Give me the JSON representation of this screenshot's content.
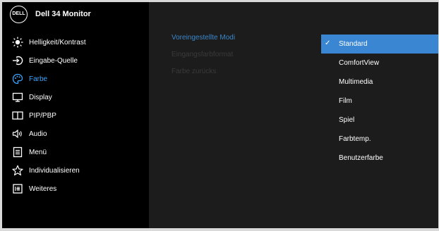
{
  "header": {
    "logo_text": "DELL",
    "title": "Dell 34 Monitor"
  },
  "menu": [
    {
      "label": "Helligkeit/Kontrast",
      "icon": "brightness-icon",
      "active": false
    },
    {
      "label": "Eingabe-Quelle",
      "icon": "input-source-icon",
      "active": false
    },
    {
      "label": "Farbe",
      "icon": "color-palette-icon",
      "active": true
    },
    {
      "label": "Display",
      "icon": "display-icon",
      "active": false
    },
    {
      "label": "PIP/PBP",
      "icon": "pip-pbp-icon",
      "active": false
    },
    {
      "label": "Audio",
      "icon": "speaker-icon",
      "active": false
    },
    {
      "label": "Menü",
      "icon": "menu-icon",
      "active": false
    },
    {
      "label": "Individualisieren",
      "icon": "star-icon",
      "active": false
    },
    {
      "label": "Weiteres",
      "icon": "others-icon",
      "active": false
    }
  ],
  "submenu": [
    {
      "label": "Voreingestellte Modi",
      "enabled": true
    },
    {
      "label": "Eingangsfarbformat",
      "enabled": false
    },
    {
      "label": "Farbe zurücks",
      "enabled": false
    }
  ],
  "options": [
    {
      "label": "Standard",
      "selected": true
    },
    {
      "label": "ComfortView",
      "selected": false
    },
    {
      "label": "Multimedia",
      "selected": false
    },
    {
      "label": "Film",
      "selected": false
    },
    {
      "label": "Spiel",
      "selected": false
    },
    {
      "label": "Farbtemp.",
      "selected": false
    },
    {
      "label": "Benutzerfarbe",
      "selected": false
    }
  ],
  "check_mark": "✓",
  "colors": {
    "accent": "#3ea6ff",
    "selection": "#3a86d2",
    "sidebar_bg": "#000000",
    "panel_bg": "#1c1c1c"
  }
}
